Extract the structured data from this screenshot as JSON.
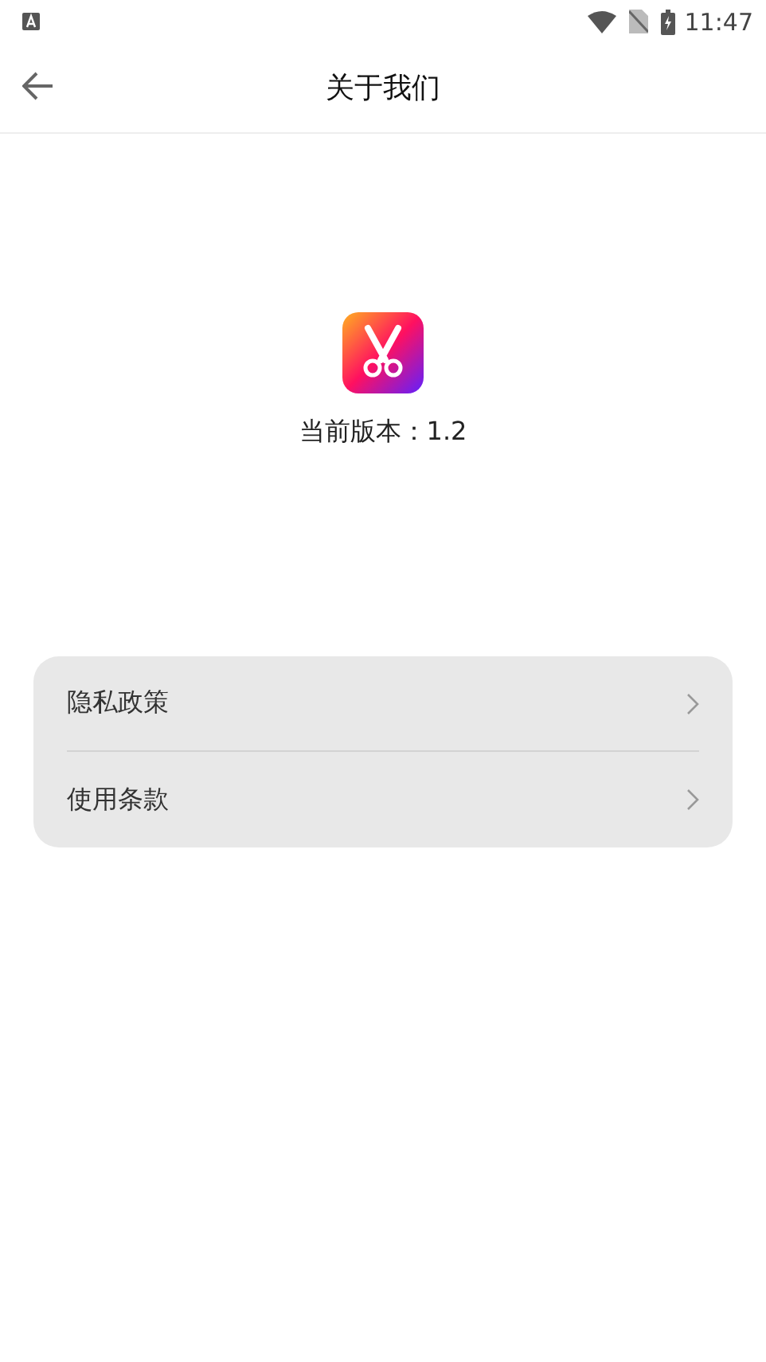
{
  "status_bar": {
    "time": "11:47"
  },
  "header": {
    "title": "关于我们"
  },
  "app_info": {
    "version": "当前版本：1.2"
  },
  "menu": [
    {
      "label": "隐私政策"
    },
    {
      "label": "使用条款"
    }
  ]
}
